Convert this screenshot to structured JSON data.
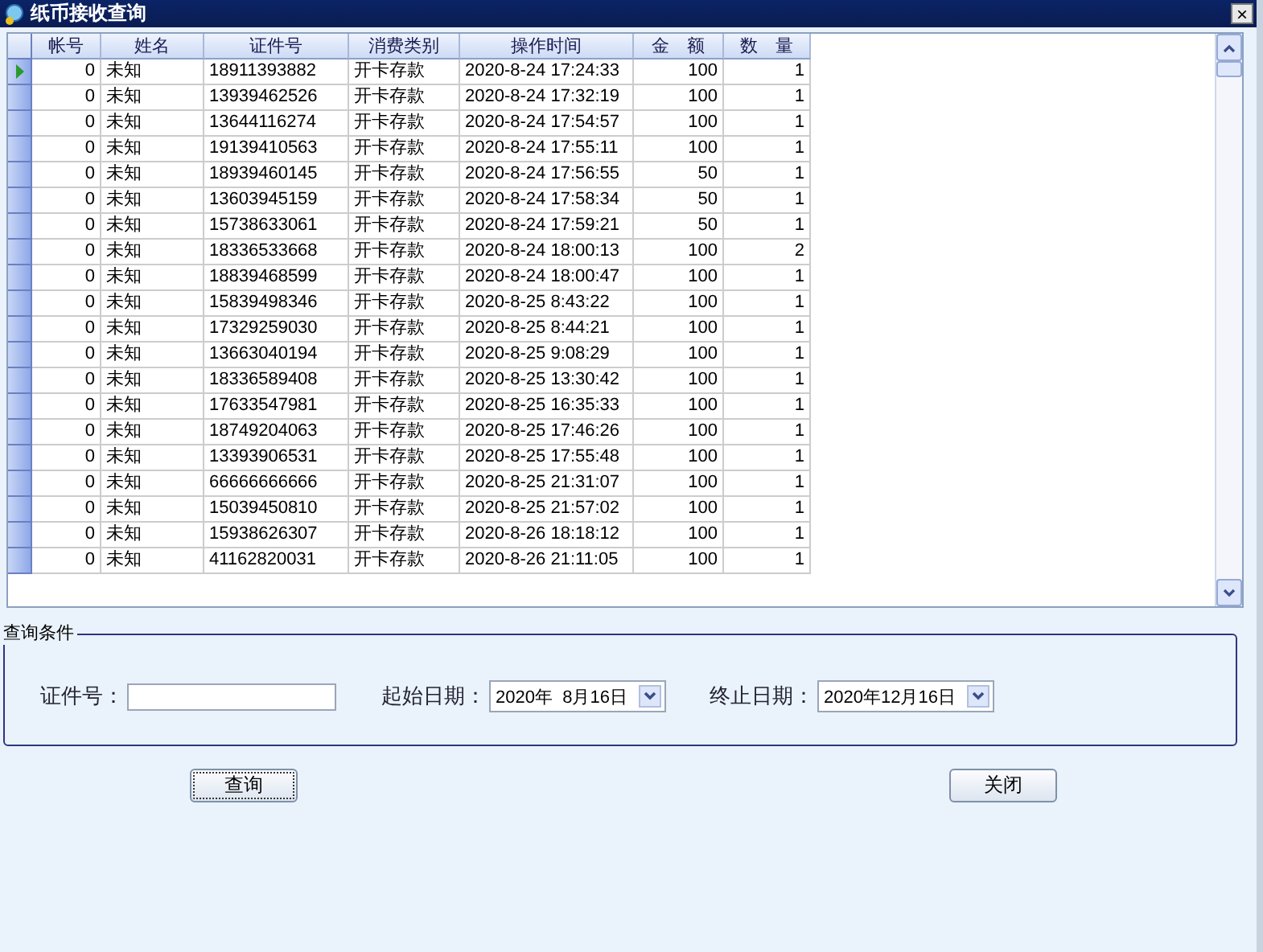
{
  "window": {
    "title": "纸币接收查询",
    "close": "×"
  },
  "table": {
    "columns": [
      "帐号",
      "姓名",
      "证件号",
      "消费类别",
      "操作时间",
      "金　额",
      "数　量"
    ],
    "rows": [
      {
        "selected": true,
        "cells": [
          "0",
          "未知",
          "18911393882",
          "开卡存款",
          "2020-8-24 17:24:33",
          "100",
          "1"
        ]
      },
      {
        "selected": false,
        "cells": [
          "0",
          "未知",
          "13939462526",
          "开卡存款",
          "2020-8-24 17:32:19",
          "100",
          "1"
        ]
      },
      {
        "selected": false,
        "cells": [
          "0",
          "未知",
          "13644116274",
          "开卡存款",
          "2020-8-24 17:54:57",
          "100",
          "1"
        ]
      },
      {
        "selected": false,
        "cells": [
          "0",
          "未知",
          "19139410563",
          "开卡存款",
          "2020-8-24 17:55:11",
          "100",
          "1"
        ]
      },
      {
        "selected": false,
        "cells": [
          "0",
          "未知",
          "18939460145",
          "开卡存款",
          "2020-8-24 17:56:55",
          "50",
          "1"
        ]
      },
      {
        "selected": false,
        "cells": [
          "0",
          "未知",
          "13603945159",
          "开卡存款",
          "2020-8-24 17:58:34",
          "50",
          "1"
        ]
      },
      {
        "selected": false,
        "cells": [
          "0",
          "未知",
          "15738633061",
          "开卡存款",
          "2020-8-24 17:59:21",
          "50",
          "1"
        ]
      },
      {
        "selected": false,
        "cells": [
          "0",
          "未知",
          "18336533668",
          "开卡存款",
          "2020-8-24 18:00:13",
          "100",
          "2"
        ]
      },
      {
        "selected": false,
        "cells": [
          "0",
          "未知",
          "18839468599",
          "开卡存款",
          "2020-8-24 18:00:47",
          "100",
          "1"
        ]
      },
      {
        "selected": false,
        "cells": [
          "0",
          "未知",
          "15839498346",
          "开卡存款",
          "2020-8-25 8:43:22",
          "100",
          "1"
        ]
      },
      {
        "selected": false,
        "cells": [
          "0",
          "未知",
          "17329259030",
          "开卡存款",
          "2020-8-25 8:44:21",
          "100",
          "1"
        ]
      },
      {
        "selected": false,
        "cells": [
          "0",
          "未知",
          "13663040194",
          "开卡存款",
          "2020-8-25 9:08:29",
          "100",
          "1"
        ]
      },
      {
        "selected": false,
        "cells": [
          "0",
          "未知",
          "18336589408",
          "开卡存款",
          "2020-8-25 13:30:42",
          "100",
          "1"
        ]
      },
      {
        "selected": false,
        "cells": [
          "0",
          "未知",
          "17633547981",
          "开卡存款",
          "2020-8-25 16:35:33",
          "100",
          "1"
        ]
      },
      {
        "selected": false,
        "cells": [
          "0",
          "未知",
          "18749204063",
          "开卡存款",
          "2020-8-25 17:46:26",
          "100",
          "1"
        ]
      },
      {
        "selected": false,
        "cells": [
          "0",
          "未知",
          "13393906531",
          "开卡存款",
          "2020-8-25 17:55:48",
          "100",
          "1"
        ]
      },
      {
        "selected": false,
        "cells": [
          "0",
          "未知",
          "66666666666",
          "开卡存款",
          "2020-8-25 21:31:07",
          "100",
          "1"
        ]
      },
      {
        "selected": false,
        "cells": [
          "0",
          "未知",
          "15039450810",
          "开卡存款",
          "2020-8-25 21:57:02",
          "100",
          "1"
        ]
      },
      {
        "selected": false,
        "cells": [
          "0",
          "未知",
          "15938626307",
          "开卡存款",
          "2020-8-26 18:18:12",
          "100",
          "1"
        ]
      },
      {
        "selected": false,
        "cells": [
          "0",
          "未知",
          "41162820031",
          "开卡存款",
          "2020-8-26 21:11:05",
          "100",
          "1"
        ]
      }
    ]
  },
  "query": {
    "title": "查询条件",
    "id_label": "证件号：",
    "start_label": "起始日期：",
    "start_value": "2020年  8月16日",
    "end_label": "终止日期：",
    "end_value": "2020年12月16日"
  },
  "buttons": [
    "查询",
    "关闭"
  ]
}
